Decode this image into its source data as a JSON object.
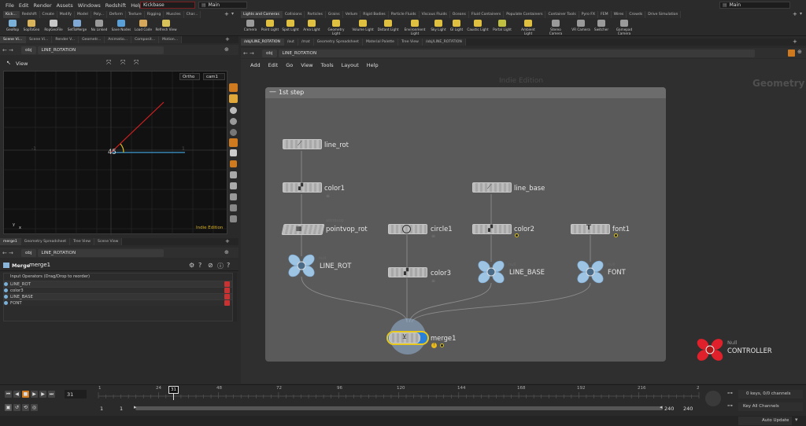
{
  "menu": [
    "File",
    "Edit",
    "Render",
    "Assets",
    "Windows",
    "Redshift",
    "Help"
  ],
  "desktops": {
    "left": "Kickbase",
    "right": "Main",
    "far_right": "Main"
  },
  "shelf_left": {
    "tabs": [
      "Kick...",
      "Redshift",
      "Create",
      "Modify",
      "Model",
      "Poly...",
      "Deform",
      "Texture",
      "Rigging",
      "Muscles",
      "Char..."
    ],
    "tools": [
      "GeoRop",
      "SopToGeo",
      "RopGeoFile",
      "SetToMerge",
      "No Linked",
      "Save Nodes",
      "Load Code",
      "Refresh View"
    ]
  },
  "shelf_right": {
    "tabs": [
      "Lights and Cameras",
      "Collisions",
      "Particles",
      "Grains",
      "Vellum",
      "Rigid Bodies",
      "Particle Fluids",
      "Viscous Fluids",
      "Oceans",
      "Fluid Containers",
      "Populate Containers",
      "Container Tools",
      "Pyro FX",
      "FEM",
      "Wires",
      "Crowds",
      "Drive Simulation"
    ],
    "tools": [
      "Camera",
      "Point Light",
      "Spot Light",
      "Area Light",
      "Geometry Light",
      "Volume Light",
      "Distant Light",
      "Environment Light",
      "Sky Light",
      "GI Light",
      "Caustic Light",
      "Portal Light",
      "Ambient Light",
      "Stereo Camera",
      "VR Camera",
      "Switcher",
      "Gamepad Camera"
    ]
  },
  "viewer": {
    "pane_tabs": [
      "Scene Vi...",
      "Scene Vi...",
      "Render V...",
      "Geometr...",
      "Animatio...",
      "Composit...",
      "Motion..."
    ],
    "path": [
      "obj",
      "LINE_ROTATION"
    ],
    "title": "View",
    "proj": "Ortho",
    "cam": "cam1",
    "tick_left": "-1",
    "tick_right": "1",
    "angle_label": "45",
    "watermark": "Indie Edition",
    "axis_y": "y",
    "axis_x": "x"
  },
  "params": {
    "pane_tabs": [
      "merge1",
      "Geometry Spreadsheet",
      "Tree View",
      "Scene View"
    ],
    "path": [
      "obj",
      "LINE_ROTATION"
    ],
    "node_type": "Merge",
    "node_name": "merge1",
    "section": "Input Operators (Drag/Drop to reorder)",
    "inputs": [
      "LINE_ROT",
      "color3",
      "LINE_BASE",
      "FONT"
    ]
  },
  "network": {
    "pane_tabs": [
      "/obj/LINE_ROTATION",
      "/out",
      "/mat",
      "Geometry Spreadsheet",
      "Material Palette",
      "Tree View",
      "/obj/LINE_ROTATION"
    ],
    "path": [
      "obj",
      "LINE_ROTATION"
    ],
    "menus": [
      "Add",
      "Edit",
      "Go",
      "View",
      "Tools",
      "Layout",
      "Help"
    ],
    "watermark": "Indie Edition",
    "context": "Geometry",
    "box_title": "1st step",
    "nodes": [
      {
        "id": "line_rot",
        "label": "line_rot",
        "type": ""
      },
      {
        "id": "color1",
        "label": "color1",
        "type": ""
      },
      {
        "id": "pointvop_rot",
        "label": "pointvop_rot",
        "type": "attribvop"
      },
      {
        "id": "line_rot_null",
        "label": "LINE_ROT",
        "type": "null"
      },
      {
        "id": "circle1",
        "label": "circle1",
        "type": ""
      },
      {
        "id": "color3",
        "label": "color3",
        "type": ""
      },
      {
        "id": "line_base",
        "label": "line_base",
        "type": ""
      },
      {
        "id": "color2",
        "label": "color2",
        "type": ""
      },
      {
        "id": "line_base_null",
        "label": "LINE_BASE",
        "type": "null"
      },
      {
        "id": "font1",
        "label": "font1",
        "type": ""
      },
      {
        "id": "font_null",
        "label": "FONT",
        "type": "null"
      },
      {
        "id": "merge1",
        "label": "merge1",
        "type": ""
      },
      {
        "id": "controller",
        "label": "CONTROLLER",
        "type": "Null"
      }
    ]
  },
  "timeline": {
    "frame": "31",
    "frame_marker": "31",
    "ticks": [
      "1",
      "24",
      "48",
      "72",
      "96",
      "120",
      "144",
      "168",
      "192",
      "216",
      "2"
    ],
    "range_start": "1",
    "range_start2": "1",
    "range_end": "240",
    "range_end2": "240",
    "keys_info": "0 keys, 0/0 channels",
    "key_channels": "Key All Channels",
    "update_mode": "Auto Update"
  },
  "colors": {
    "accent_red": "#e0202a",
    "merge_blue": "#2a7fd8",
    "highlight_yellow": "#e8c81c",
    "null_blue": "#9ec4e4"
  }
}
